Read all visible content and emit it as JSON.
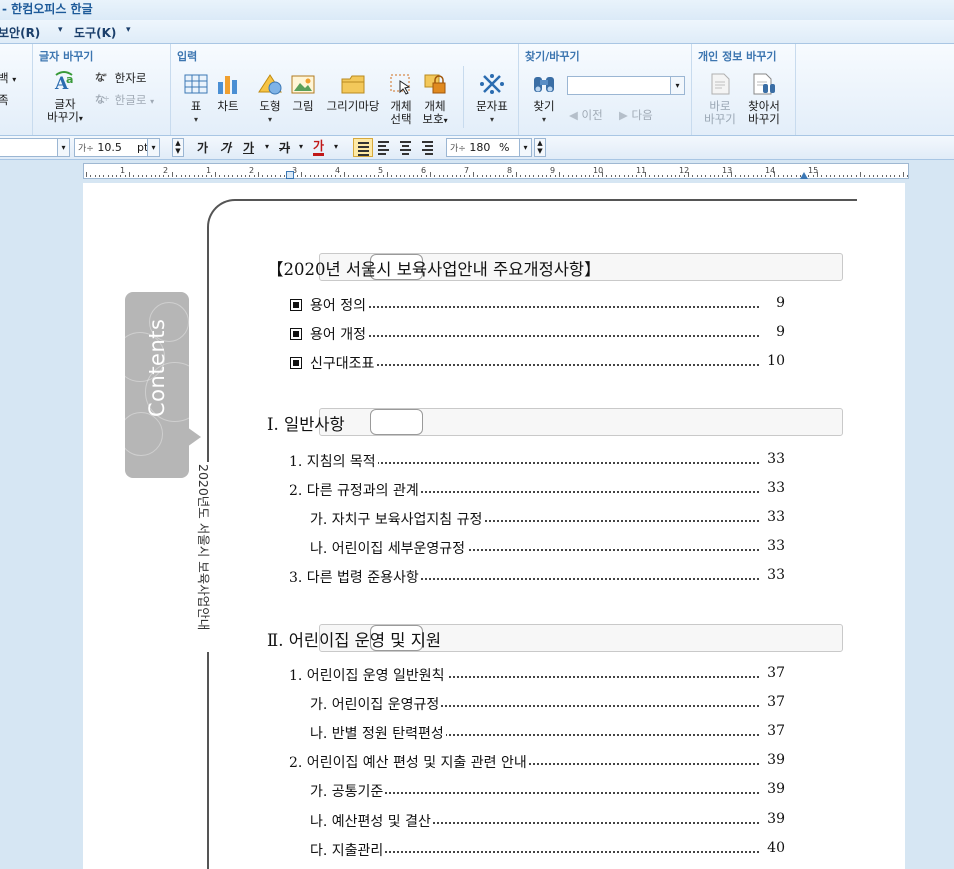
{
  "app": {
    "title": "- 한컴오피스 한글"
  },
  "menu": [
    {
      "label": "보안(R)"
    },
    {
      "label": "도구(K)"
    }
  ],
  "ribbon": {
    "left_stub": {
      "line1": "백",
      "line2": "족"
    },
    "groups": {
      "text_replace": {
        "title": "글자 바꾸기",
        "char_replace": "글자\n바꾸기",
        "char_replace_l1": "글자",
        "char_replace_l2": "바꾸기",
        "to_hanja": "한자로",
        "to_hangul": "한글로"
      },
      "insert": {
        "title": "입력",
        "table": "표",
        "chart": "차트",
        "shape": "도형",
        "picture": "그림",
        "drawing_market": "그리기마당",
        "object_select_l1": "개체",
        "object_select_l2": "선택",
        "object_protect_l1": "개체",
        "object_protect_l2": "보호",
        "char_table": "문자표"
      },
      "find_replace": {
        "title": "찾기/바꾸기",
        "find": "찾기",
        "prev": "이전",
        "next": "다음",
        "search_value": ""
      },
      "privacy": {
        "title": "개인 정보 바꾸기",
        "replace_now_l1": "바로",
        "replace_now_l2": "바꾸기",
        "find_replace_l1": "찾아서",
        "find_replace_l2": "바꾸기"
      }
    }
  },
  "format_toolbar": {
    "font_size": "10.5",
    "font_size_prefix": "가÷",
    "unit": "pt",
    "bold": "가",
    "italic": "가",
    "underline": "가",
    "strikethrough": "가",
    "font_color": "가",
    "char_width_prefix": "가÷",
    "char_width": "180",
    "char_width_unit": "%"
  },
  "ruler": {
    "numbers": [
      "1",
      "2",
      "1",
      "2",
      "3",
      "4",
      "5",
      "6",
      "7",
      "8",
      "9",
      "10",
      "11",
      "12",
      "13",
      "14",
      "15"
    ]
  },
  "document": {
    "side_tab": "Contents",
    "side_text": "2020년도 서울시 보육사업안내",
    "sections": [
      {
        "title": "【2020년 서울시 보육사업안내 주요개정사항】",
        "items": [
          {
            "label": "용어 정의",
            "page": "9",
            "bullet": true
          },
          {
            "label": "용어 개정",
            "page": "9",
            "bullet": true
          },
          {
            "label": "신구대조표",
            "page": "10",
            "bullet": true
          }
        ]
      },
      {
        "title": "Ⅰ. 일반사항",
        "items": [
          {
            "label": "1. 지침의 목적",
            "page": "33"
          },
          {
            "label": "2. 다른 규정과의 관계",
            "page": "33"
          },
          {
            "label": "가. 자치구 보육사업지침 규정",
            "page": "33",
            "sub": true
          },
          {
            "label": "나. 어린이집 세부운영규정",
            "page": "33",
            "sub": true
          },
          {
            "label": "3. 다른 법령 준용사항",
            "page": "33"
          }
        ]
      },
      {
        "title": "Ⅱ. 어린이집 운영 및 지원",
        "items": [
          {
            "label": "1. 어린이집 운영 일반원칙",
            "page": "37"
          },
          {
            "label": "가. 어린이집 운영규정",
            "page": "37",
            "sub": true
          },
          {
            "label": "나. 반별 정원 탄력편성",
            "page": "37",
            "sub": true
          },
          {
            "label": "2. 어린이집 예산 편성 및 지출 관련 안내",
            "page": "39"
          },
          {
            "label": "가. 공통기준",
            "page": "39",
            "sub": true
          },
          {
            "label": "나. 예산편성 및 결산",
            "page": "39",
            "sub": true
          },
          {
            "label": "다. 지출관리",
            "page": "40",
            "sub": true
          }
        ]
      }
    ]
  }
}
